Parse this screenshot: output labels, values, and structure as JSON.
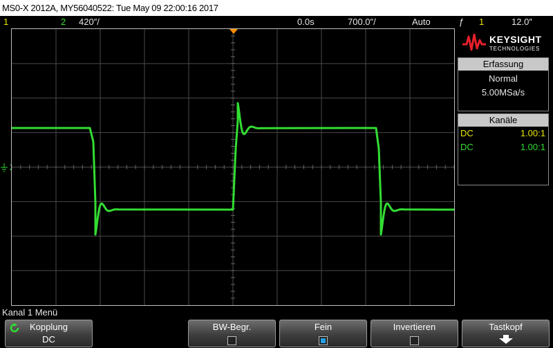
{
  "title": "MS0-X 2012A, MY56040522: Tue May 09 22:00:16 2017",
  "status": {
    "ch1_number": "1",
    "ch2_number": "2",
    "ch2_scale": "420″/",
    "time_offset": "0.0s",
    "time_scale": "700.0″/",
    "trigger_mode": "Auto",
    "trigger_symbol": "ƒ",
    "trigger_channel": "1",
    "trigger_level": "12.0″"
  },
  "marker": {
    "ch2_ground": "2"
  },
  "brand": {
    "name": "KEYSIGHT",
    "sub": "TECHNOLOGIES"
  },
  "acquisition": {
    "header": "Erfassung",
    "mode": "Normal",
    "rate": "5.00MSa/s"
  },
  "channels": {
    "header": "Kanäle",
    "rows": [
      {
        "coupling": "DC",
        "ratio": "1.00:1",
        "color": "#e8e800"
      },
      {
        "coupling": "DC",
        "ratio": "1.00:1",
        "color": "#33dd33"
      }
    ]
  },
  "menu": {
    "title": "Kanal 1 Menü",
    "softkeys": [
      {
        "label": "Kopplung",
        "value": "DC"
      },
      {
        "label": "BW-Begr.",
        "checked": false
      },
      {
        "label": "Fein",
        "checked": true
      },
      {
        "label": "Invertieren",
        "checked": false
      },
      {
        "label": "Tastkopf"
      }
    ]
  },
  "colors": {
    "ch1": "#e8e800",
    "ch2": "#33dd33",
    "trigger_marker": "#ff8c00",
    "probe_icon": "#33dd33"
  }
}
